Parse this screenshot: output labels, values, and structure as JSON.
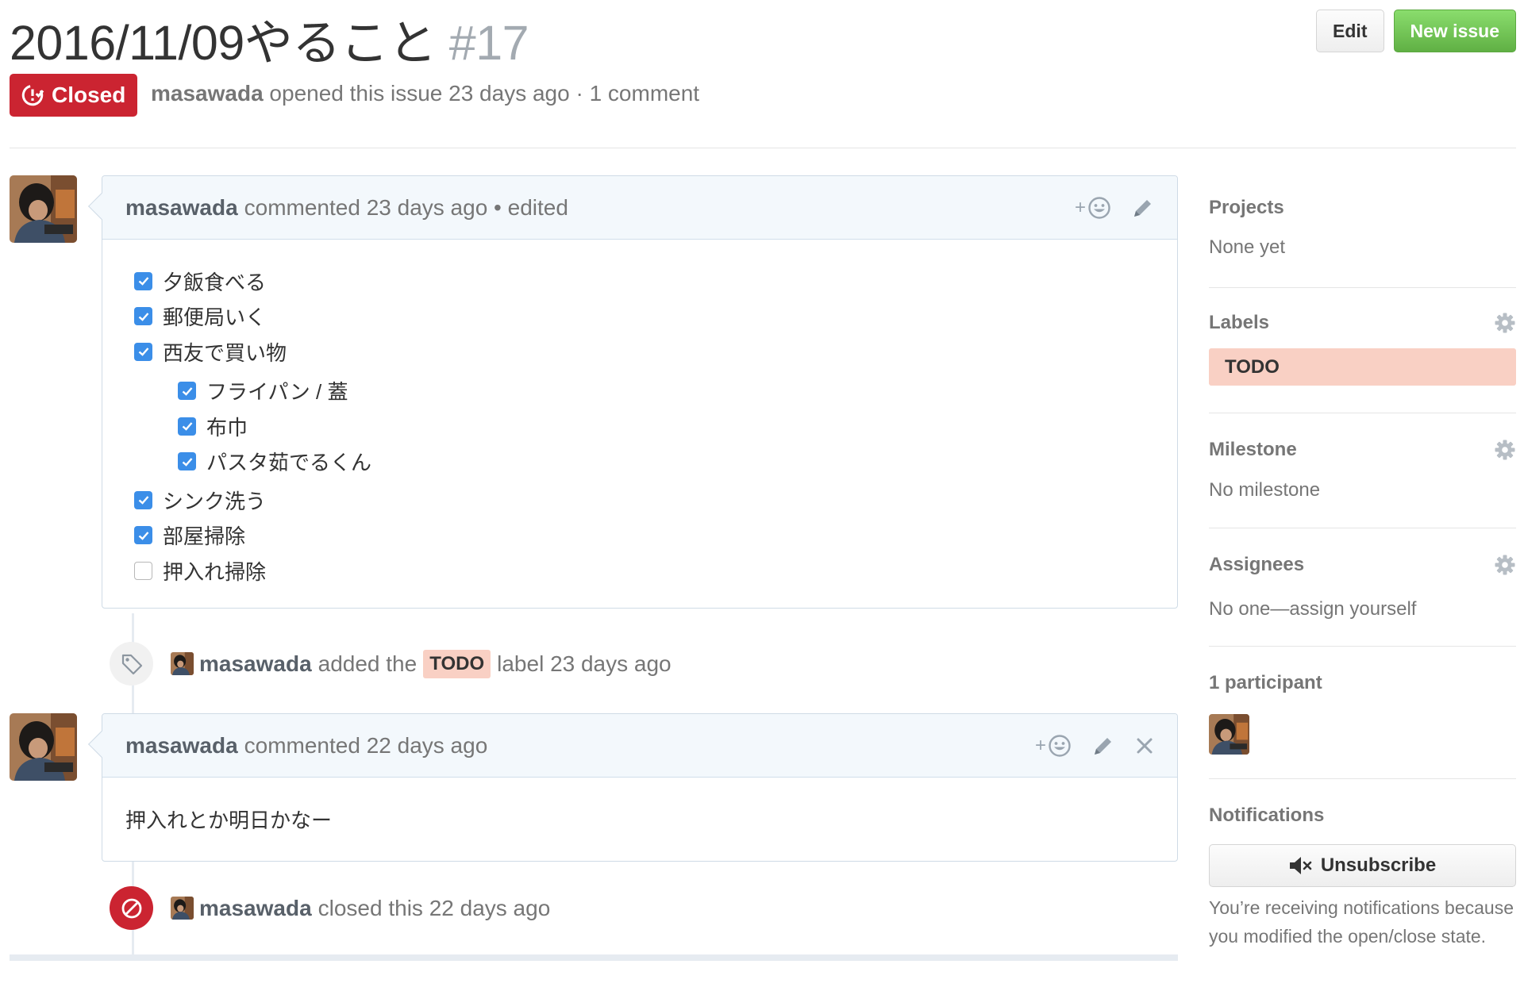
{
  "issue": {
    "title": "2016/11/09やること",
    "number": "#17",
    "state": "Closed",
    "author": "masawada",
    "meta_text": "opened this issue 23 days ago · 1 comment"
  },
  "actions": {
    "edit_label": "Edit",
    "new_issue_label": "New issue"
  },
  "colors": {
    "closed_red": "#cb2431",
    "new_issue_green": "#6cc644",
    "label_todo": "#f9d0c4",
    "checkbox_blue": "#3b8ee8"
  },
  "comments": [
    {
      "author": "masawada",
      "meta": "commented 23 days ago • edited",
      "reaction_icon": "smiley-icon",
      "tasks": [
        {
          "text": "夕飯食べる",
          "checked": true,
          "level": 0
        },
        {
          "text": "郵便局いく",
          "checked": true,
          "level": 0
        },
        {
          "text": "西友で買い物",
          "checked": true,
          "level": 0
        },
        {
          "text": "フライパン / 蓋",
          "checked": true,
          "level": 1
        },
        {
          "text": "布巾",
          "checked": true,
          "level": 1
        },
        {
          "text": "パスタ茹でるくん",
          "checked": true,
          "level": 1
        },
        {
          "text": "シンク洗う",
          "checked": true,
          "level": 0
        },
        {
          "text": "部屋掃除",
          "checked": true,
          "level": 0
        },
        {
          "text": "押入れ掃除",
          "checked": false,
          "level": 0
        }
      ]
    },
    {
      "author": "masawada",
      "meta": "commented 22 days ago",
      "body": "押入れとか明日かなー"
    }
  ],
  "events": [
    {
      "author": "masawada",
      "before": "added the",
      "label": "TODO",
      "after": "label 23 days ago"
    },
    {
      "author": "masawada",
      "text": "closed this 22 days ago"
    }
  ],
  "sidebar": {
    "projects": {
      "heading": "Projects",
      "value": "None yet"
    },
    "labels": {
      "heading": "Labels",
      "items": [
        "TODO"
      ]
    },
    "milestone": {
      "heading": "Milestone",
      "value": "No milestone"
    },
    "assignees": {
      "heading": "Assignees",
      "value": "No one—assign yourself"
    },
    "participants": {
      "heading": "1 participant"
    },
    "notifications": {
      "heading": "Notifications",
      "button_label": "Unsubscribe",
      "note": "You’re receiving notifications because you modified the open/close state."
    }
  }
}
